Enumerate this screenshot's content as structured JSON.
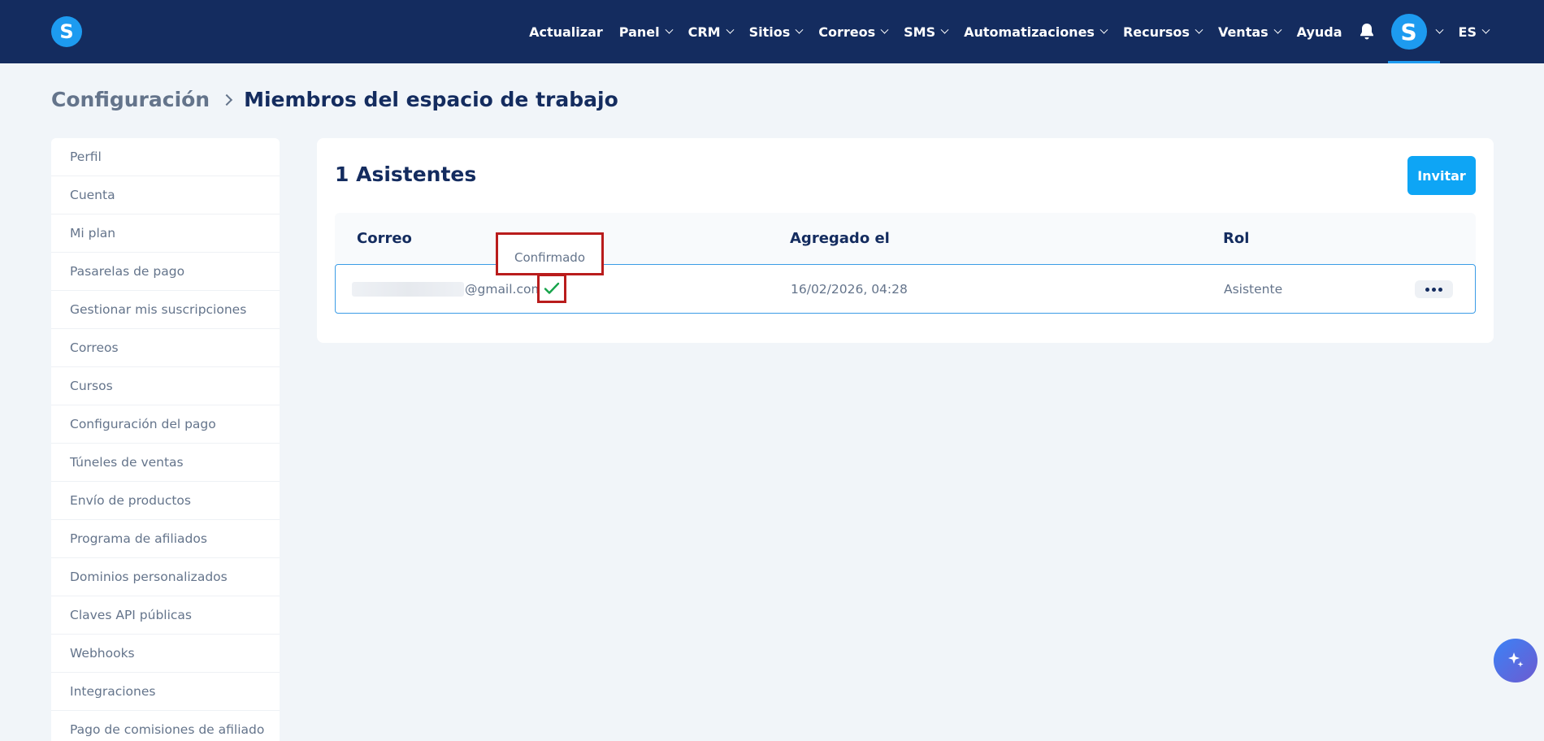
{
  "brand": {
    "logo_letter": "S",
    "accent": "#1d9bf0",
    "nav_bg": "#142c5f"
  },
  "nav": {
    "items": [
      {
        "label": "Actualizar",
        "dropdown": false
      },
      {
        "label": "Panel",
        "dropdown": true
      },
      {
        "label": "CRM",
        "dropdown": true
      },
      {
        "label": "Sitios",
        "dropdown": true
      },
      {
        "label": "Correos",
        "dropdown": true
      },
      {
        "label": "SMS",
        "dropdown": true
      },
      {
        "label": "Automatizaciones",
        "dropdown": true
      },
      {
        "label": "Recursos",
        "dropdown": true
      },
      {
        "label": "Ventas",
        "dropdown": true
      },
      {
        "label": "Ayuda",
        "dropdown": false
      }
    ],
    "bell_icon": "bell-icon",
    "avatar_letter": "S",
    "language": "ES"
  },
  "breadcrumb": {
    "parent": "Configuración",
    "current": "Miembros del espacio de trabajo"
  },
  "sidebar": {
    "items": [
      "Perfil",
      "Cuenta",
      "Mi plan",
      "Pasarelas de pago",
      "Gestionar mis suscripciones",
      "Correos",
      "Cursos",
      "Configuración del pago",
      "Túneles de ventas",
      "Envío de productos",
      "Programa de afiliados",
      "Dominios personalizados",
      "Claves API públicas",
      "Webhooks",
      "Integraciones",
      "Pago de comisiones de afiliado"
    ]
  },
  "main": {
    "title": "1 Asistentes",
    "invite_label": "Invitar",
    "table": {
      "headers": {
        "email": "Correo",
        "added": "Agregado el",
        "role": "Rol"
      },
      "rows": [
        {
          "email_domain": "@gmail.com",
          "added": "16/02/2026, 04:28",
          "role": "Asistente",
          "confirmed": true
        }
      ]
    },
    "tooltip": "Confirmado"
  }
}
